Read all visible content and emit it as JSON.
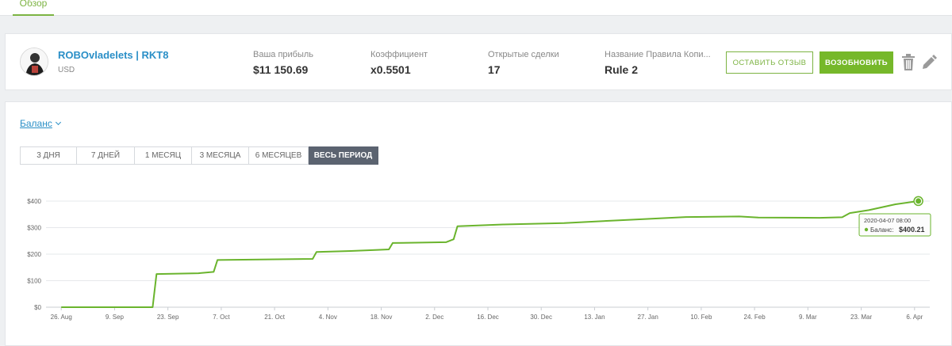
{
  "nav": {
    "tab_label": "Обзор"
  },
  "strategy": {
    "name": "ROBOvladelets | RKT8",
    "currency": "USD",
    "stats": [
      {
        "label": "Ваша прибыль",
        "value": "$11 150.69"
      },
      {
        "label": "Коэффициент",
        "value": "x0.5501"
      },
      {
        "label": "Открытые сделки",
        "value": "17"
      },
      {
        "label": "Название Правила Копи...",
        "value": "Rule 2"
      }
    ],
    "review_button": "ОСТАВИТЬ ОТЗЫВ",
    "renew_button": "ВОЗОБНОВИТЬ"
  },
  "chart_panel": {
    "metric_label": "Баланс",
    "periods": [
      "3 ДНЯ",
      "7 ДНЕЙ",
      "1 МЕСЯЦ",
      "3 МЕСЯЦА",
      "6 МЕСЯЦЕВ",
      "ВЕСЬ ПЕРИОД"
    ],
    "active_period": "ВЕСЬ ПЕРИОД"
  },
  "tooltip": {
    "date": "2020-04-07 08:00",
    "series_label": "Баланс:",
    "value": "$400.21"
  },
  "colors": {
    "accent": "#7cb342",
    "link": "#2a8fc7",
    "line": "#6ab42d"
  },
  "chart_data": {
    "type": "line",
    "series": [
      {
        "name": "Баланс",
        "points": [
          [
            "2019-08-26",
            0
          ],
          [
            "2019-09-19",
            0
          ],
          [
            "2019-09-20",
            125
          ],
          [
            "2019-10-01",
            128
          ],
          [
            "2019-10-05",
            133
          ],
          [
            "2019-10-06",
            178
          ],
          [
            "2019-10-31",
            182
          ],
          [
            "2019-11-01",
            208
          ],
          [
            "2019-11-10",
            212
          ],
          [
            "2019-11-17",
            216
          ],
          [
            "2019-11-20",
            218
          ],
          [
            "2019-11-21",
            242
          ],
          [
            "2019-12-05",
            245
          ],
          [
            "2019-12-07",
            256
          ],
          [
            "2019-12-08",
            305
          ],
          [
            "2019-12-20",
            312
          ],
          [
            "2020-01-05",
            317
          ],
          [
            "2020-01-20",
            328
          ],
          [
            "2020-02-06",
            340
          ],
          [
            "2020-02-20",
            342
          ],
          [
            "2020-02-25",
            338
          ],
          [
            "2020-03-12",
            337
          ],
          [
            "2020-03-18",
            339
          ],
          [
            "2020-03-20",
            355
          ],
          [
            "2020-03-25",
            366
          ],
          [
            "2020-04-01",
            388
          ],
          [
            "2020-04-07",
            400.21
          ]
        ]
      }
    ],
    "x_ticks": [
      "26. Aug",
      "9. Sep",
      "23. Sep",
      "7. Oct",
      "21. Oct",
      "4. Nov",
      "18. Nov",
      "2. Dec",
      "16. Dec",
      "30. Dec",
      "13. Jan",
      "27. Jan",
      "10. Feb",
      "24. Feb",
      "9. Mar",
      "23. Mar",
      "6. Apr"
    ],
    "y_ticks": [
      "$0",
      "$100",
      "$200",
      "$300",
      "$400"
    ],
    "x_range": [
      "2019-08-22",
      "2020-04-10"
    ],
    "ylim": [
      0,
      400
    ],
    "grid": true,
    "legend": "none"
  }
}
